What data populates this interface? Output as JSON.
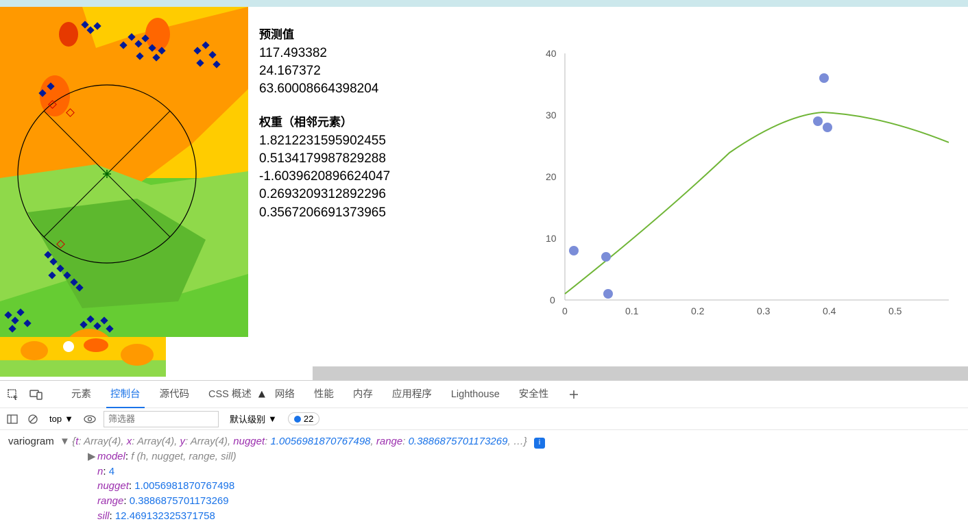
{
  "info": {
    "pred_title": "预测值",
    "pred_vals": [
      "117.493382",
      "24.167372",
      "63.60008664398204"
    ],
    "weight_title": "权重（相邻元素）",
    "weight_vals": [
      "1.8212231595902455",
      "0.5134179987829288",
      "-1.6039620896624047",
      "0.2693209312892296",
      "0.3567206691373965"
    ]
  },
  "chart_data": {
    "type": "scatter+line",
    "xlim": [
      0,
      0.58
    ],
    "ylim": [
      0,
      40
    ],
    "xticks": [
      "0",
      "0.1",
      "0.2",
      "0.3",
      "0.4",
      "0.5"
    ],
    "yticks": [
      "0",
      "10",
      "20",
      "30",
      "40"
    ],
    "scatter": [
      {
        "x": 0.013,
        "y": 8
      },
      {
        "x": 0.062,
        "y": 7
      },
      {
        "x": 0.065,
        "y": 1
      },
      {
        "x": 0.382,
        "y": 29
      },
      {
        "x": 0.392,
        "y": 36
      },
      {
        "x": 0.397,
        "y": 28
      }
    ],
    "curve_note": "green fitted variogram curve rising from ~1 at x=0 to ~30.5 near x=0.39 then slight decline"
  },
  "devtools": {
    "tabs": [
      "元素",
      "控制台",
      "源代码",
      "CSS 概述",
      "网络",
      "性能",
      "内存",
      "应用程序",
      "Lighthouse",
      "安全性"
    ],
    "active_tab": 1,
    "context": "top",
    "filter_placeholder": "筛选器",
    "level": "默认级别",
    "issue_count": "22",
    "console": {
      "var_name": "variogram",
      "summary_props": [
        {
          "k": "t",
          "v": "Array(4)"
        },
        {
          "k": "x",
          "v": "Array(4)"
        },
        {
          "k": "y",
          "v": "Array(4)"
        },
        {
          "k": "nugget",
          "v": "1.0056981870767498"
        },
        {
          "k": "range",
          "v": "0.3886875701173269"
        }
      ],
      "expanded": [
        {
          "k": "model",
          "v": "f (h, nugget, range, sill)",
          "fn": true
        },
        {
          "k": "n",
          "v": "4"
        },
        {
          "k": "nugget",
          "v": "1.0056981870767498"
        },
        {
          "k": "range",
          "v": "0.3886875701173269"
        },
        {
          "k": "sill",
          "v": "12.469132325371758"
        }
      ]
    }
  }
}
